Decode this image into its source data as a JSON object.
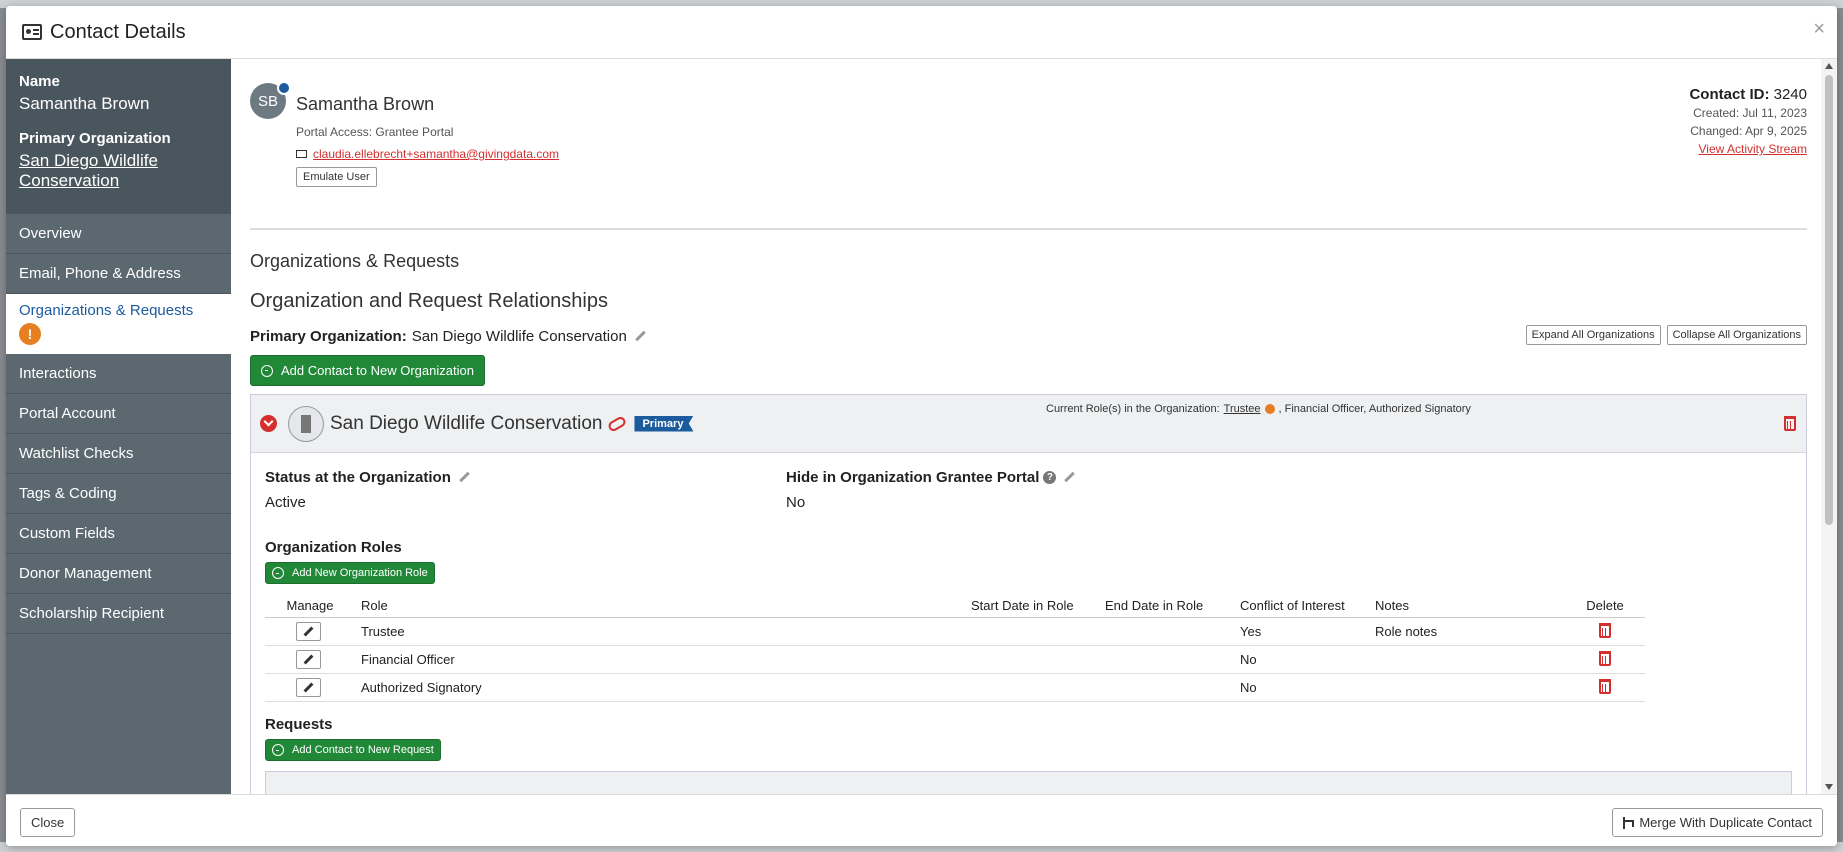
{
  "modal": {
    "title": "Contact Details",
    "close_symbol": "×"
  },
  "sidebar": {
    "name_label": "Name",
    "name_value": "Samantha Brown",
    "org_label": "Primary Organization",
    "org_value": "San Diego Wildlife Conservation",
    "items": [
      {
        "label": "Overview"
      },
      {
        "label": "Email, Phone & Address"
      },
      {
        "label": "Organizations & Requests",
        "warning": "!"
      },
      {
        "label": "Interactions"
      },
      {
        "label": "Portal Account"
      },
      {
        "label": "Watchlist Checks"
      },
      {
        "label": "Tags & Coding"
      },
      {
        "label": "Custom Fields"
      },
      {
        "label": "Donor Management"
      },
      {
        "label": "Scholarship Recipient"
      }
    ]
  },
  "contact": {
    "initials": "SB",
    "name": "Samantha Brown",
    "portal_access": "Portal Access: Grantee Portal",
    "email": "claudia.ellebrecht+samantha@givingdata.com",
    "emulate_label": "Emulate User",
    "id_label": "Contact ID:",
    "id_value": "3240",
    "created": "Created: Jul 11, 2023",
    "changed": "Changed: Apr 9, 2025",
    "activity_link": "View Activity Stream"
  },
  "section": {
    "title": "Organizations & Requests",
    "subtitle": "Organization and Request Relationships",
    "primary_label": "Primary Organization:",
    "primary_value": "San Diego Wildlife Conservation",
    "expand_label": "Expand All Organizations",
    "collapse_label": "Collapse All Organizations",
    "add_org_label": "Add Contact to New Organization"
  },
  "org_card": {
    "name": "San Diego Wildlife Conservation",
    "primary_tag": "Primary",
    "roles_prefix": "Current Role(s) in the Organization:",
    "roles_first": "Trustee",
    "roles_rest": ", Financial Officer, Authorized Signatory",
    "status_label": "Status at the Organization",
    "status_value": "Active",
    "hide_label": "Hide in Organization Grantee Portal",
    "hide_value": "No",
    "roles_title": "Organization Roles",
    "add_role_label": "Add New Organization Role",
    "table_headers": {
      "manage": "Manage",
      "role": "Role",
      "start": "Start Date in Role",
      "end": "End Date in Role",
      "coi": "Conflict of Interest",
      "notes": "Notes",
      "delete": "Delete"
    },
    "roles": [
      {
        "role": "Trustee",
        "start": "",
        "end": "",
        "coi": "Yes",
        "notes": "Role notes"
      },
      {
        "role": "Financial Officer",
        "start": "",
        "end": "",
        "coi": "No",
        "notes": ""
      },
      {
        "role": "Authorized Signatory",
        "start": "",
        "end": "",
        "coi": "No",
        "notes": ""
      }
    ],
    "requests_title": "Requests",
    "add_request_label": "Add Contact to New Request"
  },
  "footer": {
    "close_label": "Close",
    "merge_label": "Merge With Duplicate Contact"
  }
}
